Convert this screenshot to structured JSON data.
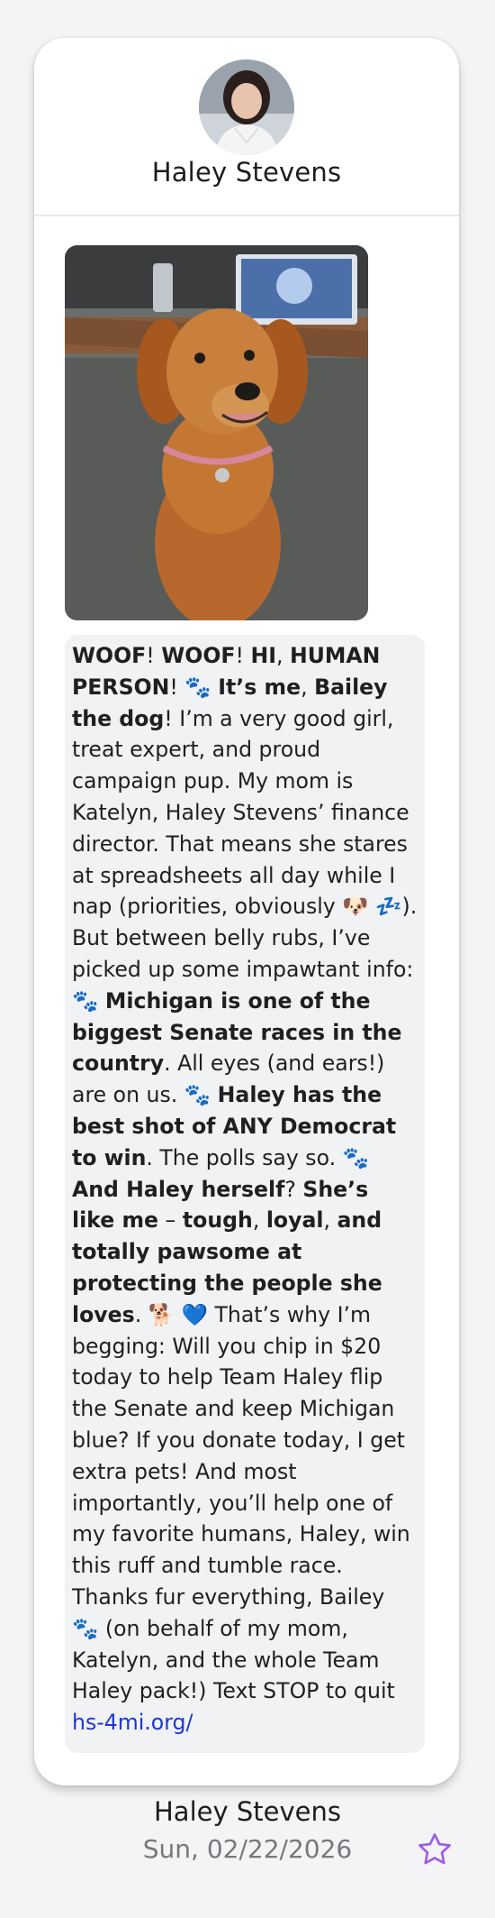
{
  "contact": {
    "name": "Haley Stevens"
  },
  "message": {
    "segments": [
      {
        "t": "WOOF",
        "b": true
      },
      {
        "t": "! "
      },
      {
        "t": "WOOF",
        "b": true
      },
      {
        "t": "! "
      },
      {
        "t": "HI",
        "b": true
      },
      {
        "t": ", "
      },
      {
        "t": "HUMAN PERSON",
        "b": true
      },
      {
        "t": "! 🐾 "
      },
      {
        "t": "It’s me",
        "b": true
      },
      {
        "t": ", "
      },
      {
        "t": "Bailey the dog",
        "b": true
      },
      {
        "t": "! I’m a very good girl, treat expert, and proud campaign pup. My mom is Katelyn, Haley Stevens’ finance director. That means she stares at spreadsheets all day while I nap (priorities, obviously 🐶 💤). But between belly rubs, I’ve picked up some impawtant info: 🐾 "
      },
      {
        "t": "Michigan is one of the biggest Senate races in the country",
        "b": true
      },
      {
        "t": ". All eyes (and ears!) are on us. 🐾 "
      },
      {
        "t": "Haley has the best shot of ANY Democrat to win",
        "b": true
      },
      {
        "t": ". The polls say so. 🐾 "
      },
      {
        "t": "And Haley herself",
        "b": true
      },
      {
        "t": "? "
      },
      {
        "t": "She’s like me",
        "b": true
      },
      {
        "t": " – "
      },
      {
        "t": "tough",
        "b": true
      },
      {
        "t": ", "
      },
      {
        "t": "loyal",
        "b": true
      },
      {
        "t": ", "
      },
      {
        "t": "and totally pawsome at protecting the people she loves",
        "b": true
      },
      {
        "t": ". 🐕 💙 That’s why I’m begging: Will you chip in $20 today to help Team Haley flip the Senate and keep Michigan blue? If you donate today, I get extra pets! And most importantly, you’ll help one of my favorite humans, Haley, win this ruff and tumble race. Thanks fur everything, Bailey 🐾 (on behalf of my mom, Katelyn, and the whole Team Haley pack!) Text STOP to quit"
      }
    ],
    "link": "hs-4mi.org/"
  },
  "footer": {
    "name": "Haley Stevens",
    "date": "Sun, 02/22/2026"
  },
  "colors": {
    "link": "#1d36d6",
    "star": "#9b5de5"
  },
  "icons": {
    "favorite": "star-outline-icon"
  }
}
